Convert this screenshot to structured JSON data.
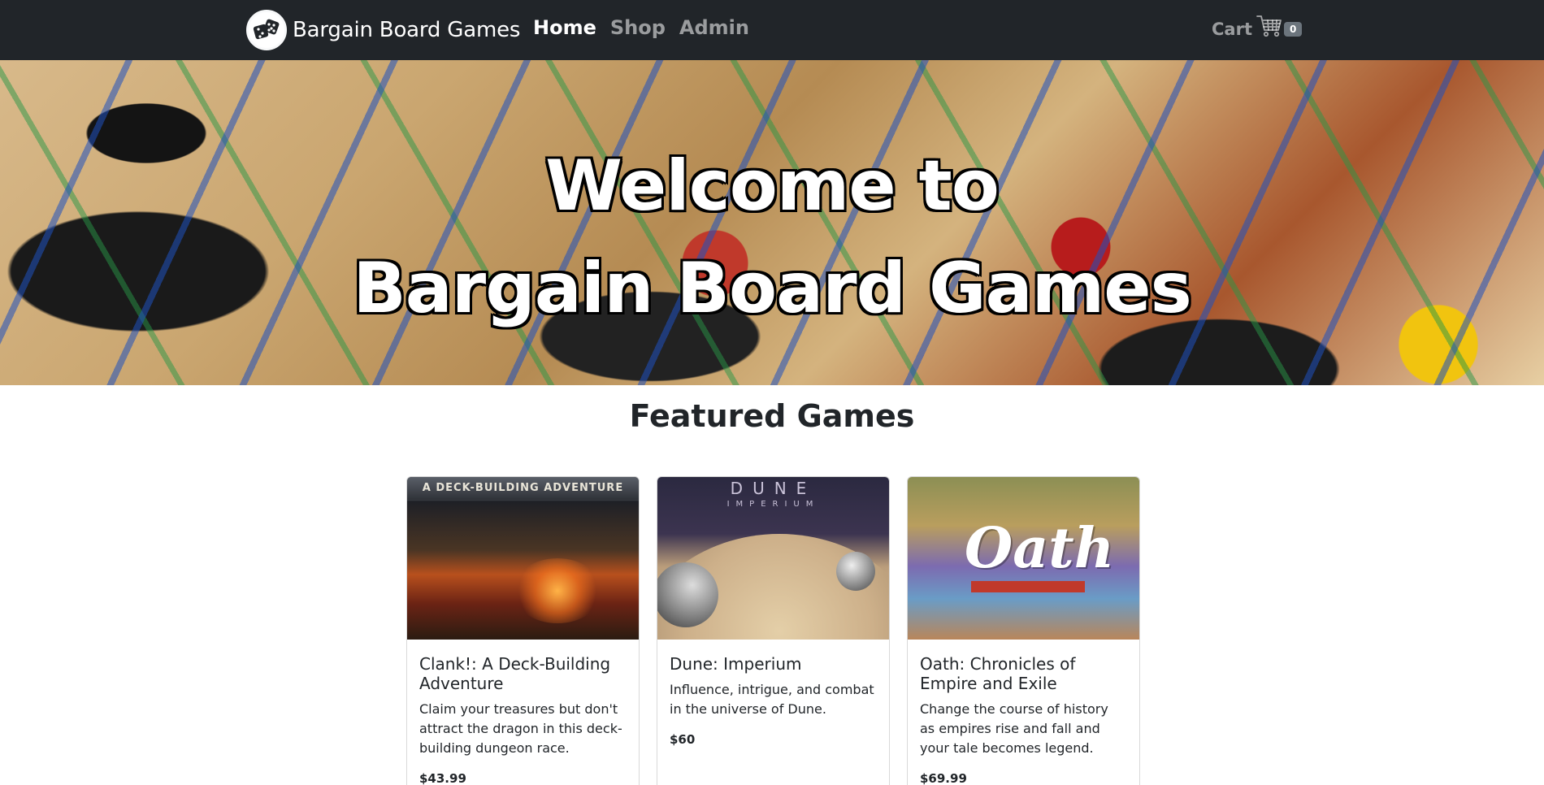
{
  "navbar": {
    "brand_name": "Bargain Board Games",
    "links": [
      {
        "label": "Home",
        "active": true
      },
      {
        "label": "Shop",
        "active": false
      },
      {
        "label": "Admin",
        "active": false
      }
    ],
    "cart_label": "Cart",
    "cart_count": "0",
    "colors": {
      "background": "#212529",
      "text_active": "#ffffff",
      "text_muted": "rgba(255,255,255,0.55)"
    }
  },
  "hero": {
    "title_line1": "Welcome to",
    "title_line2": "Bargain Board Games"
  },
  "featured": {
    "title": "Featured Games",
    "cards": [
      {
        "title": "Clank!: A Deck-Building Adventure",
        "description": "Claim your treasures but don't attract the dragon in this deck-building dungeon race.",
        "price": "$43.99",
        "image_banner": "A DECK-BUILDING ADVENTURE"
      },
      {
        "title": "Dune: Imperium",
        "description": "Influence, intrigue, and combat in the universe of Dune.",
        "price": "$60",
        "image_title": "DUNE",
        "image_subtitle": "IMPERIUM"
      },
      {
        "title": "Oath: Chronicles of Empire and Exile",
        "description": "Change the course of history as empires rise and fall and your tale becomes legend.",
        "price": "$69.99",
        "image_title": "Oath"
      }
    ]
  }
}
